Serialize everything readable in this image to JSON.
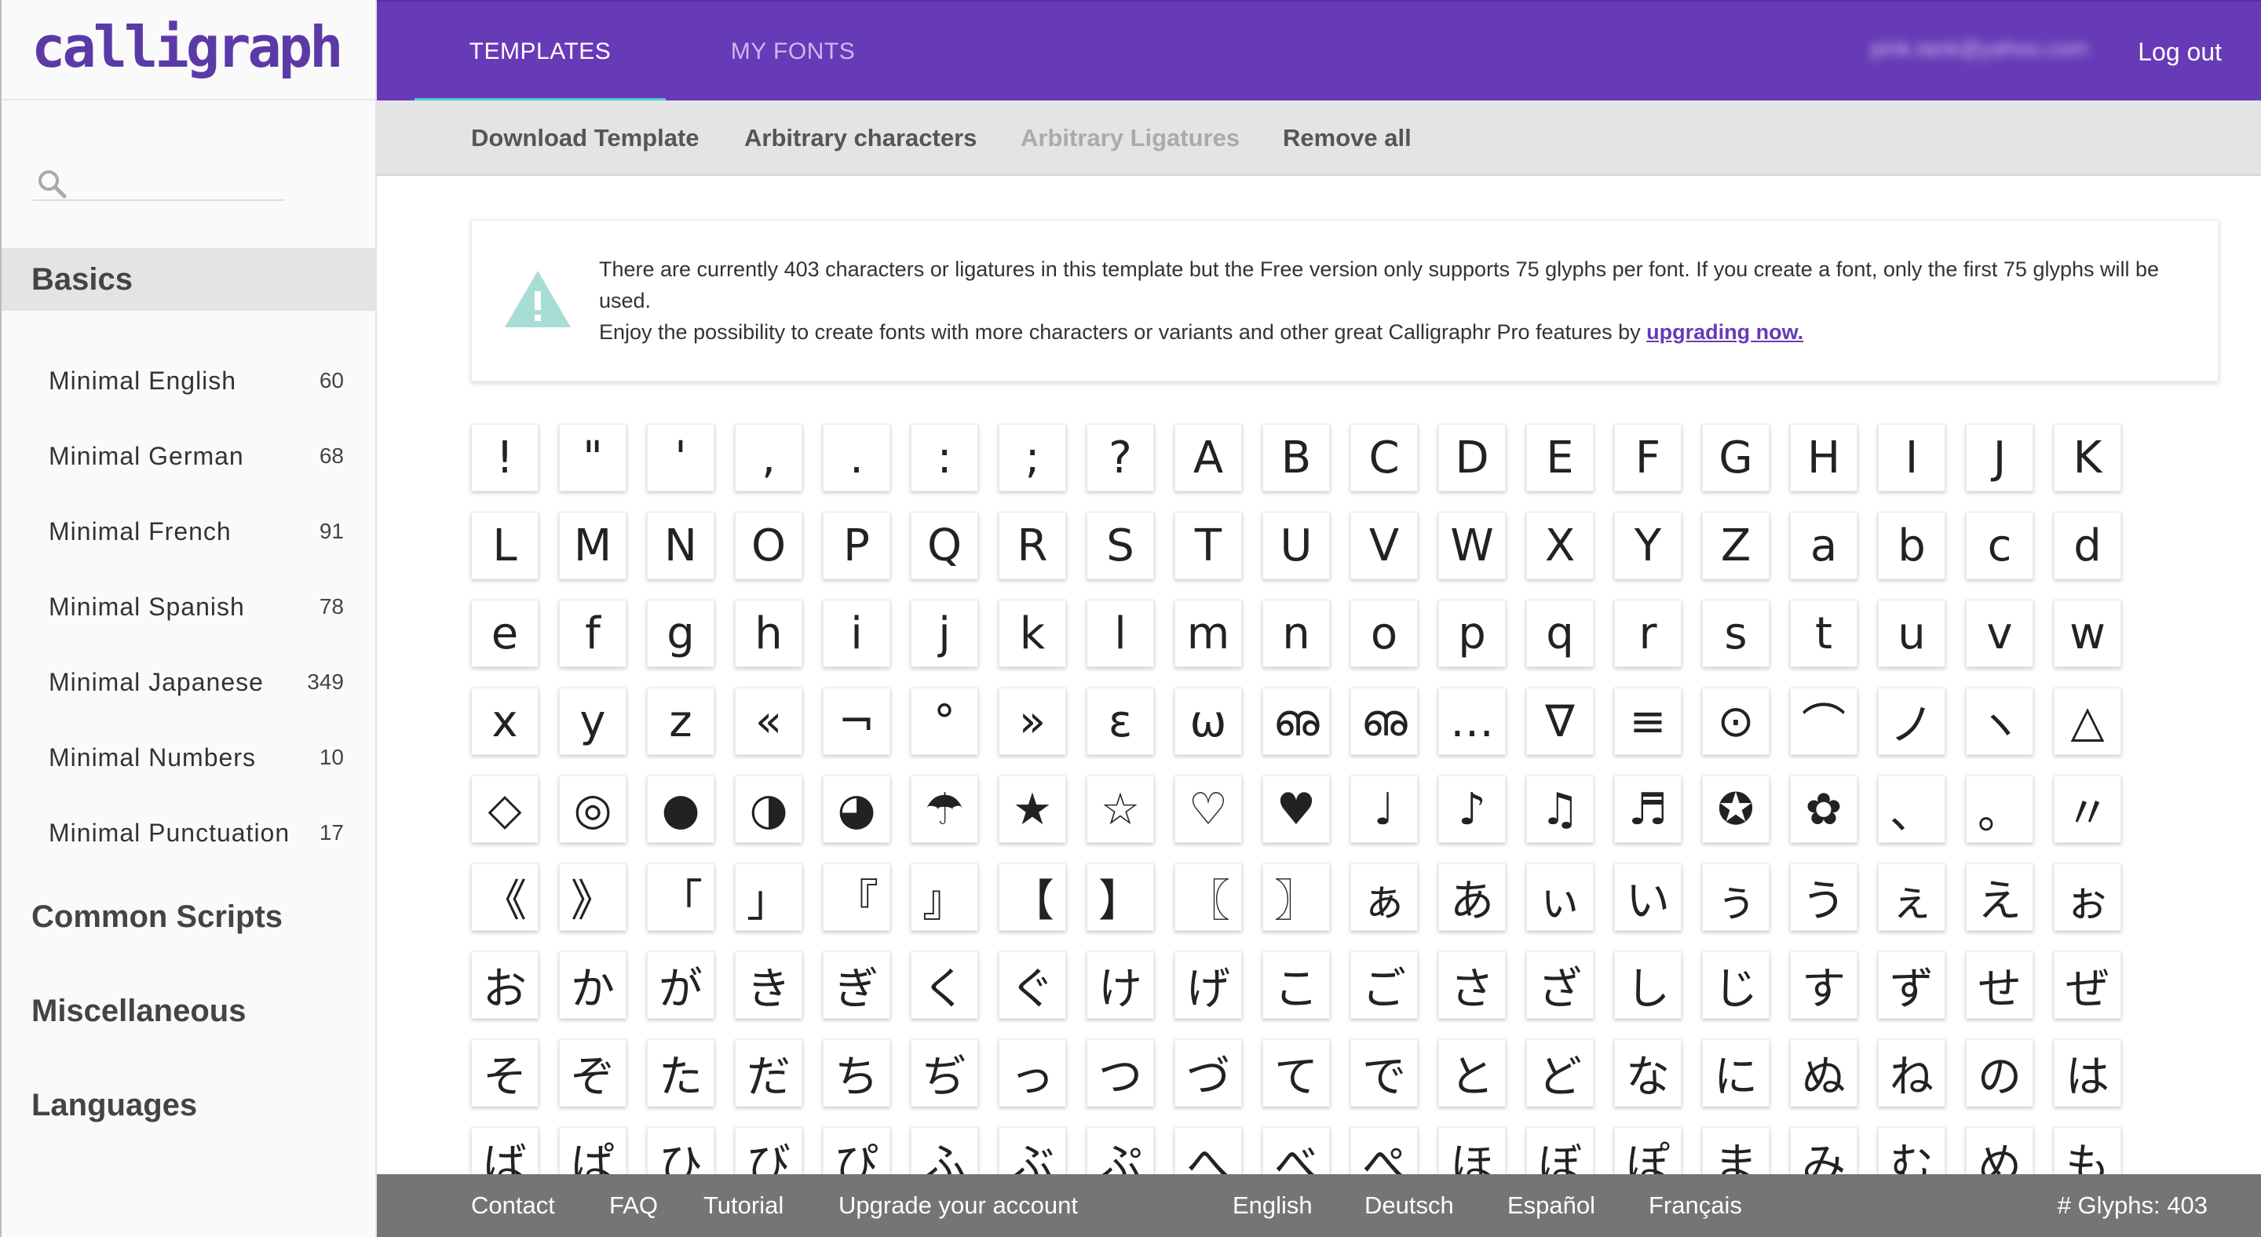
{
  "brand": {
    "logo_text": "calligraphr",
    "accent": "#673ab7",
    "logo_color": "#5b3aa8"
  },
  "topbar": {
    "tabs": [
      {
        "label": "TEMPLATES",
        "active": true
      },
      {
        "label": "MY FONTS",
        "active": false
      }
    ],
    "user_email": "pink.tank@yahoo.com",
    "logout_label": "Log out"
  },
  "toolbar": {
    "download_template": "Download Template",
    "arbitrary_characters": "Arbitrary characters",
    "arbitrary_ligatures": "Arbitrary Ligatures",
    "remove_all": "Remove all"
  },
  "sidebar": {
    "search_placeholder": "",
    "categories": {
      "basics": "Basics",
      "common_scripts": "Common Scripts",
      "miscellaneous": "Miscellaneous",
      "languages": "Languages"
    },
    "basics_items": [
      {
        "label": "Minimal English",
        "count": "60"
      },
      {
        "label": "Minimal German",
        "count": "68"
      },
      {
        "label": "Minimal French",
        "count": "91"
      },
      {
        "label": "Minimal Spanish",
        "count": "78"
      },
      {
        "label": "Minimal Japanese",
        "count": "349"
      },
      {
        "label": "Minimal Numbers",
        "count": "10"
      },
      {
        "label": "Minimal Punctuation",
        "count": "17"
      }
    ]
  },
  "notice": {
    "line1": "There are currently 403 characters or ligatures in this template but the Free version only supports 75 glyphs per font. If you create a font, only the first 75 glyphs will be used.",
    "line2": "Enjoy the possibility to create fonts with more characters or variants and other great Calligraphr Pro features by ",
    "link": "upgrading now."
  },
  "glyphs": [
    "!",
    "\"",
    "'",
    ",",
    ".",
    ":",
    ";",
    "?",
    "A",
    "B",
    "C",
    "D",
    "E",
    "F",
    "G",
    "H",
    "I",
    "J",
    "K",
    "L",
    "M",
    "N",
    "O",
    "P",
    "Q",
    "R",
    "S",
    "T",
    "U",
    "V",
    "W",
    "X",
    "Y",
    "Z",
    "a",
    "b",
    "c",
    "d",
    "e",
    "f",
    "g",
    "h",
    "i",
    "j",
    "k",
    "l",
    "m",
    "n",
    "o",
    "p",
    "q",
    "r",
    "s",
    "t",
    "u",
    "v",
    "w",
    "x",
    "y",
    "z",
    "«",
    "¬",
    "°",
    "»",
    "ε",
    "ω",
    "ഌ",
    "ഌ",
    "…",
    "∇",
    "≡",
    "⊙",
    "⌒",
    "ノ",
    "ヽ",
    "△",
    "◇",
    "◎",
    "●",
    "◑",
    "◕",
    "☂",
    "★",
    "☆",
    "♡",
    "♥",
    "♩",
    "♪",
    "♫",
    "♬",
    "✪",
    "✿",
    "、",
    "。",
    "〃",
    "《",
    "》",
    "「",
    "」",
    "『",
    "』",
    "【",
    "】",
    "〖",
    "〗",
    "ぁ",
    "あ",
    "ぃ",
    "い",
    "ぅ",
    "う",
    "ぇ",
    "え",
    "ぉ",
    "お",
    "か",
    "が",
    "き",
    "ぎ",
    "く",
    "ぐ",
    "け",
    "げ",
    "こ",
    "ご",
    "さ",
    "ざ",
    "し",
    "じ",
    "す",
    "ず",
    "せ",
    "ぜ",
    "そ",
    "ぞ",
    "た",
    "だ",
    "ち",
    "ぢ",
    "っ",
    "つ",
    "づ",
    "て",
    "で",
    "と",
    "ど",
    "な",
    "に",
    "ぬ",
    "ね",
    "の",
    "は",
    "ば",
    "ぱ",
    "ひ",
    "び",
    "ぴ",
    "ふ",
    "ぶ",
    "ぷ",
    "へ",
    "べ",
    "ぺ",
    "ほ",
    "ぼ",
    "ぽ",
    "ま",
    "み",
    "む",
    "め",
    "も"
  ],
  "footer": {
    "links": [
      "Contact",
      "FAQ",
      "Tutorial",
      "Upgrade your account"
    ],
    "languages": [
      "English",
      "Deutsch",
      "Español",
      "Français"
    ],
    "glyph_count": "# Glyphs: 403"
  }
}
